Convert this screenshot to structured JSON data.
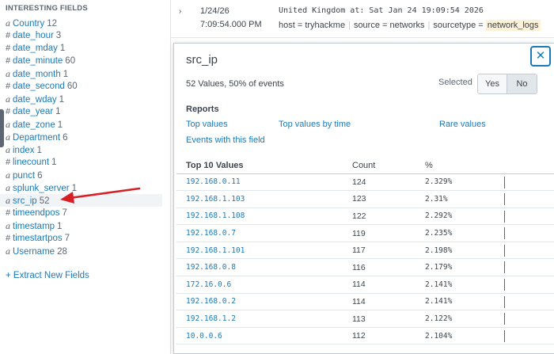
{
  "sidebar": {
    "heading": "INTERESTING FIELDS",
    "fields": [
      {
        "type": "a",
        "name": "Country",
        "count": "12"
      },
      {
        "type": "#",
        "name": "date_hour",
        "count": "3"
      },
      {
        "type": "#",
        "name": "date_mday",
        "count": "1"
      },
      {
        "type": "#",
        "name": "date_minute",
        "count": "60"
      },
      {
        "type": "a",
        "name": "date_month",
        "count": "1"
      },
      {
        "type": "#",
        "name": "date_second",
        "count": "60"
      },
      {
        "type": "a",
        "name": "date_wday",
        "count": "1"
      },
      {
        "type": "#",
        "name": "date_year",
        "count": "1"
      },
      {
        "type": "a",
        "name": "date_zone",
        "count": "1"
      },
      {
        "type": "a",
        "name": "Department",
        "count": "6"
      },
      {
        "type": "a",
        "name": "index",
        "count": "1"
      },
      {
        "type": "#",
        "name": "linecount",
        "count": "1"
      },
      {
        "type": "a",
        "name": "punct",
        "count": "6"
      },
      {
        "type": "a",
        "name": "splunk_server",
        "count": "1"
      },
      {
        "type": "a",
        "name": "src_ip",
        "count": "52"
      },
      {
        "type": "#",
        "name": "timeendpos",
        "count": "7"
      },
      {
        "type": "a",
        "name": "timestamp",
        "count": "1"
      },
      {
        "type": "#",
        "name": "timestartpos",
        "count": "7"
      },
      {
        "type": "a",
        "name": "Username",
        "count": "28"
      }
    ],
    "extract_link": "+ Extract New Fields"
  },
  "event": {
    "chevron": "›",
    "date": "1/24/26",
    "time": "7:09:54.000 PM",
    "raw": "United Kingdom at: Sat Jan 24 19:09:54 2026",
    "host_label": "host = ",
    "host": "tryhackme",
    "source_label": "source = ",
    "source": "networks",
    "sourcetype_label": "sourcetype = ",
    "sourcetype": "network_logs"
  },
  "popup": {
    "title": "src_ip",
    "close": "✕",
    "summary": "52 Values, 50% of events",
    "selected_label": "Selected",
    "yes": "Yes",
    "no": "No",
    "reports_heading": "Reports",
    "reports": {
      "top_values": "Top values",
      "top_by_time": "Top values by time",
      "rare": "Rare values",
      "events": "Events with this field"
    },
    "table": {
      "headers": {
        "value": "Top 10 Values",
        "count": "Count",
        "percent": "%"
      },
      "rows": [
        {
          "value": "192.168.0.11",
          "count": "124",
          "percent": "2.329%"
        },
        {
          "value": "192.168.1.103",
          "count": "123",
          "percent": "2.31%"
        },
        {
          "value": "192.168.1.108",
          "count": "122",
          "percent": "2.292%"
        },
        {
          "value": "192.168.0.7",
          "count": "119",
          "percent": "2.235%"
        },
        {
          "value": "192.168.1.101",
          "count": "117",
          "percent": "2.198%"
        },
        {
          "value": "192.168.0.8",
          "count": "116",
          "percent": "2.179%"
        },
        {
          "value": "172.16.0.6",
          "count": "114",
          "percent": "2.141%"
        },
        {
          "value": "192.168.0.2",
          "count": "114",
          "percent": "2.141%"
        },
        {
          "value": "192.168.1.2",
          "count": "113",
          "percent": "2.122%"
        },
        {
          "value": "10.0.0.6",
          "count": "112",
          "percent": "2.104%"
        }
      ]
    }
  },
  "colors": {
    "link": "#1a7ab8",
    "annotation_arrow": "#d71f26",
    "text": "#3c444d"
  },
  "highlighted_field": "src_ip"
}
